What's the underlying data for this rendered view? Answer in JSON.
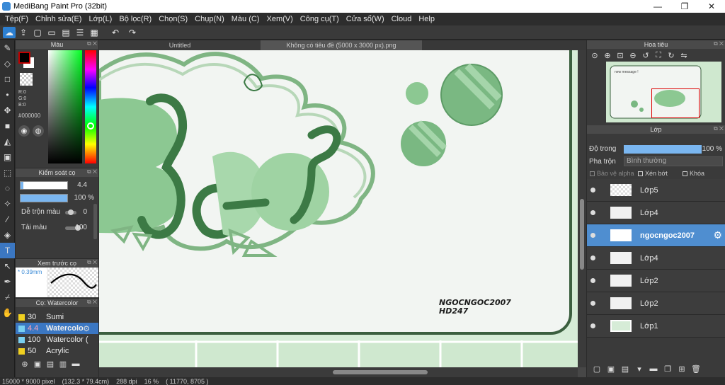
{
  "window": {
    "title": "MediBang Paint Pro (32bit)",
    "minimize_glyph": "—",
    "maximize_glyph": "❐",
    "close_glyph": "✕"
  },
  "menu": [
    "Tệp(F)",
    "Chỉnh sửa(E)",
    "Lớp(L)",
    "Bộ lọc(R)",
    "Chọn(S)",
    "Chụp(N)",
    "Màu (C)",
    "Xem(V)",
    "Công cụ(T)",
    "Cửa sổ(W)",
    "Cloud",
    "Help"
  ],
  "color_panel": {
    "title": "Màu",
    "r": "R:0",
    "g": "G:0",
    "b": "B:0",
    "hex": "#000000",
    "fg_color": "#000000",
    "bg_color": "#ffffff"
  },
  "brush_control": {
    "title": "Kiểm soát cọ",
    "size": "4.4",
    "opacity": "100 %",
    "blend_label": "Dễ trộn màu",
    "blend_value": "0",
    "amount_label": "Tải màu",
    "amount_value": "100"
  },
  "brush_preview": {
    "title": "Xem trước cọ",
    "size_text": "* 0.39mm"
  },
  "brush_list": {
    "title": "Cọ: Watercolor",
    "items": [
      {
        "size": "30",
        "name": "Sumi",
        "color": "#f0d020"
      },
      {
        "size": "4.4",
        "name": "Watercolo",
        "color": "#7ad0f0"
      },
      {
        "size": "100",
        "name": "Watercolor (",
        "color": "#7ad0f0"
      },
      {
        "size": "50",
        "name": "Acrylic",
        "color": "#f0d020"
      }
    ]
  },
  "canvas": {
    "tab1": "Untitled",
    "tab2": "Không có tiêu đề (5000 x 3000 px).png",
    "signature_line1": "NGOCNGOC2007",
    "signature_line2": "HD247"
  },
  "navigator": {
    "title": "Hoa tiêu",
    "thumb_text": "new message !"
  },
  "layer_panel": {
    "title": "Lớp",
    "opacity_label": "Độ trong",
    "opacity_value": "100 %",
    "blend_label": "Pha trộn",
    "blend_value": "Bình thường",
    "protect_alpha": "Bảo vệ alpha",
    "clipping": "Xén bớt",
    "lock": "Khóa",
    "layers": [
      "Lớp5",
      "Lớp4",
      "ngocngoc2007",
      "Lớp4",
      "Lớp2",
      "Lớp2",
      "Lớp1"
    ],
    "active_index": 2
  },
  "status": {
    "dimensions": "15000 * 9000 pixel",
    "physical": "(132.3 * 79.4cm)",
    "dpi": "288 dpi",
    "zoom": "16 %",
    "coords": "( 11770, 8705 )"
  },
  "icons": {
    "brush-icon": "🖌",
    "eraser-icon": "⌫",
    "move-icon": "✥",
    "text-icon": "T",
    "hand-icon": "✋"
  }
}
